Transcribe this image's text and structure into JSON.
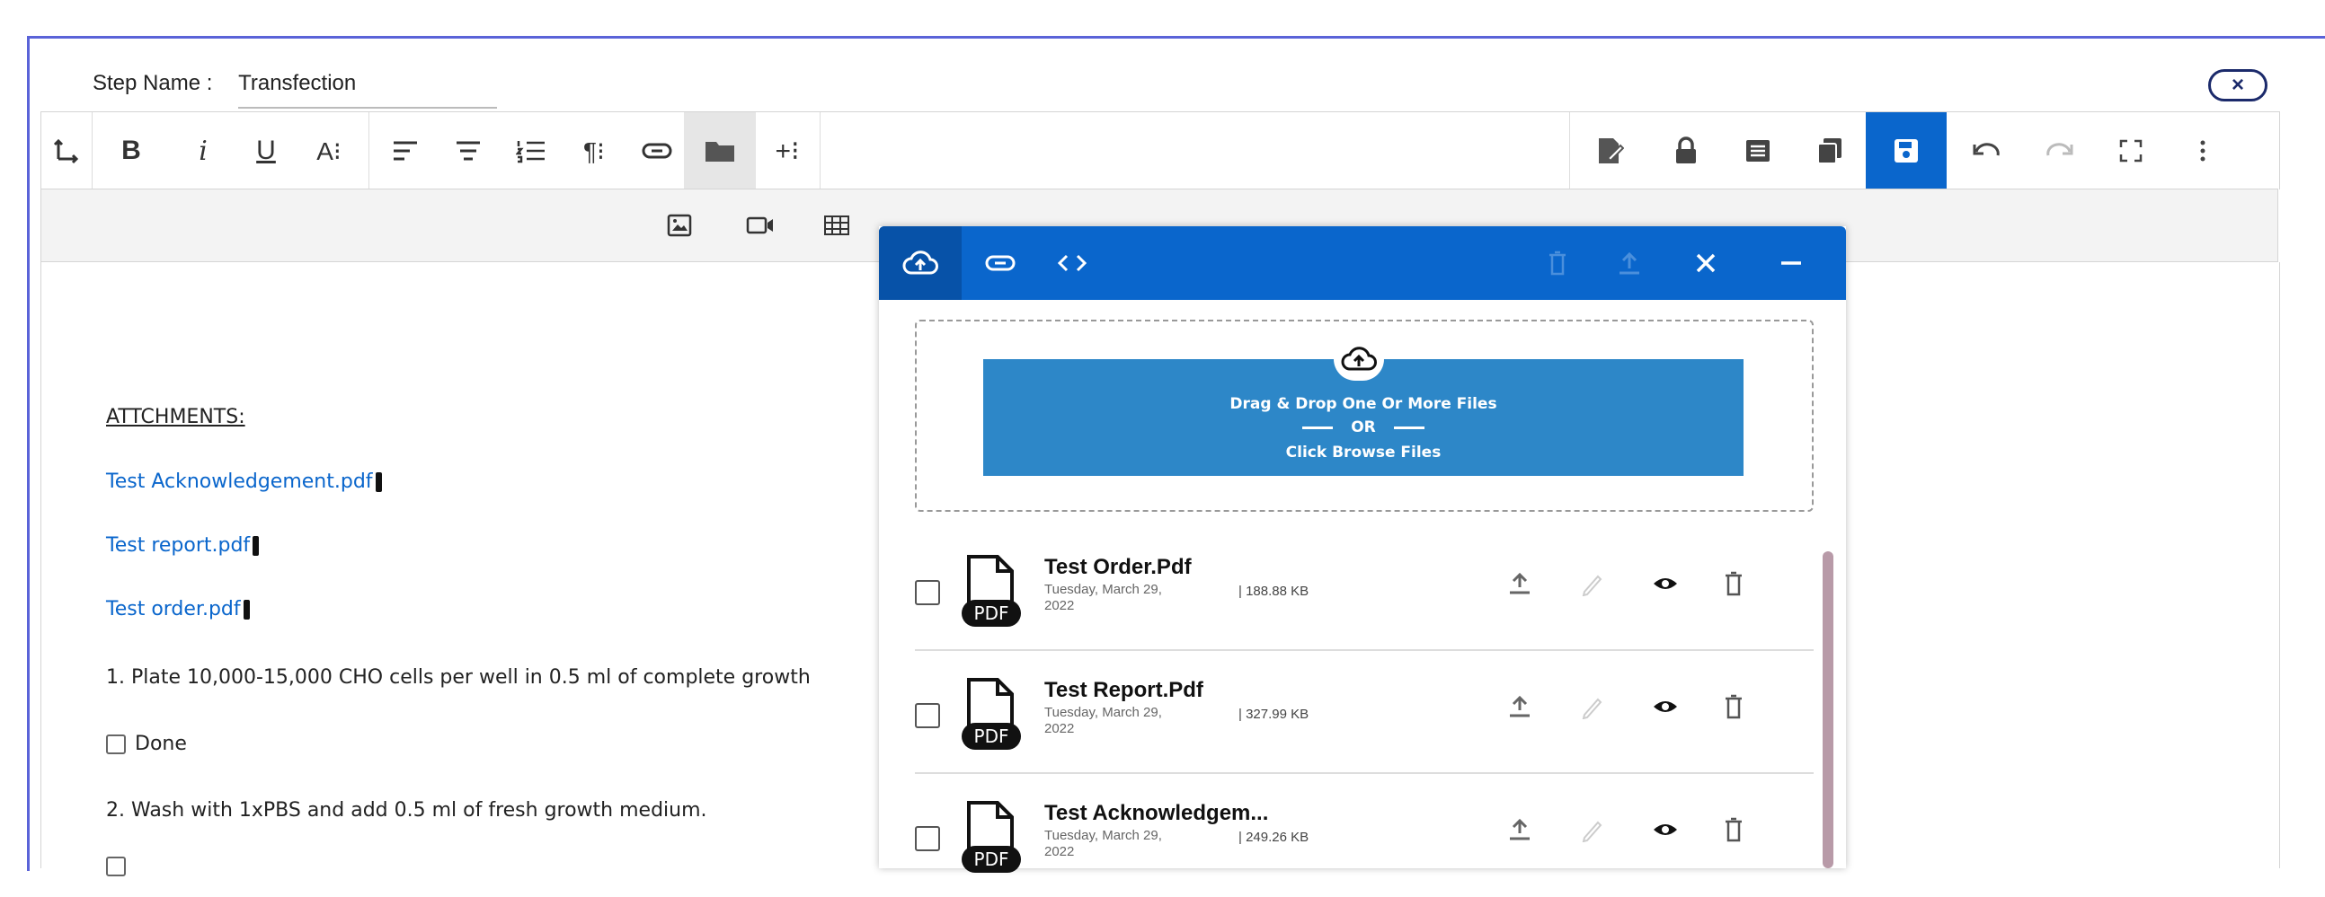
{
  "step": {
    "label": "Step Name :",
    "value": "Transfection"
  },
  "close_label": "×",
  "toolbar": {
    "buttons": [
      "⭥",
      "B",
      "i",
      "U",
      "A⁝",
      "☰",
      "☰",
      "☰",
      "¶⁝",
      "⊖",
      "▬",
      "+⁝",
      "✎",
      "🔒",
      "▤",
      "❐",
      "💾",
      "↶",
      "↷",
      "⛶",
      "⋮"
    ],
    "sub_buttons": [
      "🖼",
      "🎥",
      "▦"
    ]
  },
  "content": {
    "heading": "ATTCHMENTS:",
    "links": [
      "Test Acknowledgement.pdf",
      "Test report.pdf",
      "Test order.pdf"
    ],
    "step1": "1. Plate 10,000-15,000 CHO cells per well in 0.5 ml of complete growth",
    "done_label": "Done",
    "step2": "2. Wash with 1xPBS and add 0.5 ml of fresh growth medium."
  },
  "panel": {
    "head_icons": [
      "upload-cloud-icon",
      "link-icon",
      "code-icon",
      "trash-icon",
      "upload-icon",
      "close-icon",
      "minimize-icon"
    ],
    "dropzone": {
      "line1": "Drag & Drop One Or More Files",
      "line2": "OR",
      "line3": "Click Browse Files"
    },
    "files": [
      {
        "name": "Test Order.Pdf",
        "date": "Tuesday, March 29, 2022",
        "size": "| 188.88 KB",
        "type": "PDF"
      },
      {
        "name": "Test Report.Pdf",
        "date": "Tuesday, March 29, 2022",
        "size": "| 327.99 KB",
        "type": "PDF"
      },
      {
        "name": "Test Acknowledgem...",
        "date": "Tuesday, March 29, 2022",
        "size": "| 249.26 KB",
        "type": "PDF"
      }
    ]
  },
  "colors": {
    "accent": "#0a66cc",
    "dropzone": "#2d87c8",
    "window_border": "#5a63d8"
  }
}
